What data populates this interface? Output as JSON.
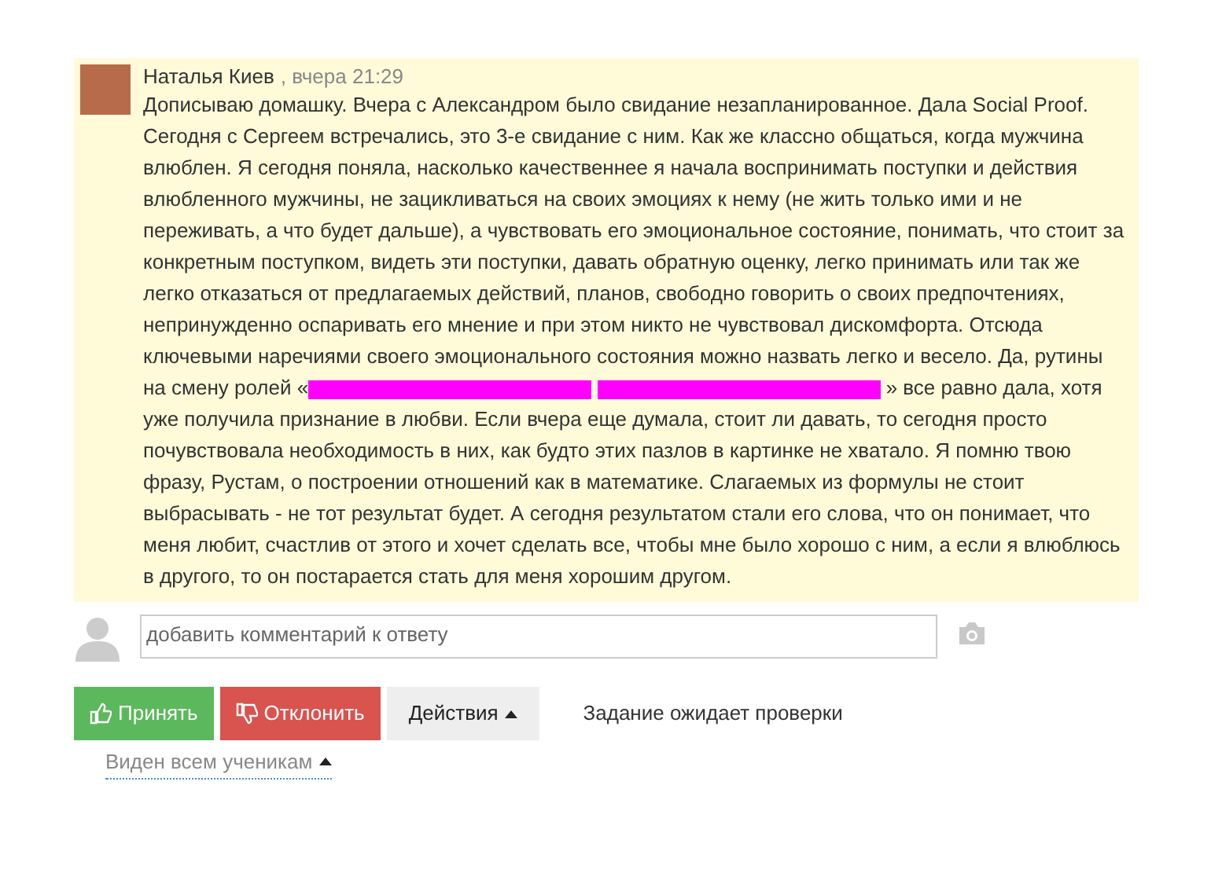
{
  "post": {
    "author": "Наталья Киев",
    "time": ", вчера 21:29",
    "paragraphs": [
      [
        {
          "kind": "text",
          "text": "Дописываю домашку. Вчера с Александром было свидание незапланированное. Дала Social Proof."
        }
      ],
      [
        {
          "kind": "text",
          "text": "Сегодня с Сергеем встречались, это 3-е свидание с ним. Как же классно общаться, когда мужчина влюблен. Я сегодня поняла, насколько качественнее я начала воспринимать поступки и действия влюбленного мужчины, не зацикливаться на своих эмоциях к нему (не жить только ими и не переживать, а что будет дальше), а чувствовать его эмоциональное состояние, понимать, что стоит за конкретным поступком, видеть эти поступки, давать обратную оценку, легко принимать или так же легко отказаться от предлагаемых действий, планов, свободно говорить о своих предпочтениях, непринужденно оспаривать его мнение и при этом никто не чувствовал дискомфорта. Отсюда ключевыми наречиями своего эмоционального состояния можно назвать легко и весело. Да, рутины на смену ролей «"
        },
        {
          "kind": "redaction"
        },
        {
          "kind": "redaction"
        },
        {
          "kind": "text",
          "text": "» все равно дала, хотя уже получила признание в любви. Если вчера еще думала, стоит ли давать, то сегодня просто почувствовала необходимость в них, как будто этих пазлов в картинке не хватало. Я помню твою фразу, Рустам, о построении отношений как в математике. Слагаемых из формулы не стоит выбрасывать - не тот результат будет. А сегодня результатом стали его слова, что он понимает, что меня любит, счастлив от этого и хочет сделать все, чтобы мне было хорошо с ним, а если я влюблюсь в другого, то он постарается стать для меня хорошим другом."
        }
      ]
    ]
  },
  "comment": {
    "placeholder": "добавить комментарий к ответу"
  },
  "buttons": [
    {
      "label": "Принять",
      "kind": "accept"
    },
    {
      "label": "Отклонить",
      "kind": "reject"
    },
    {
      "label": "Действия",
      "kind": "dropdown"
    }
  ],
  "status": "Задание ожидает проверки",
  "visibility": "Виден всем ученикам"
}
